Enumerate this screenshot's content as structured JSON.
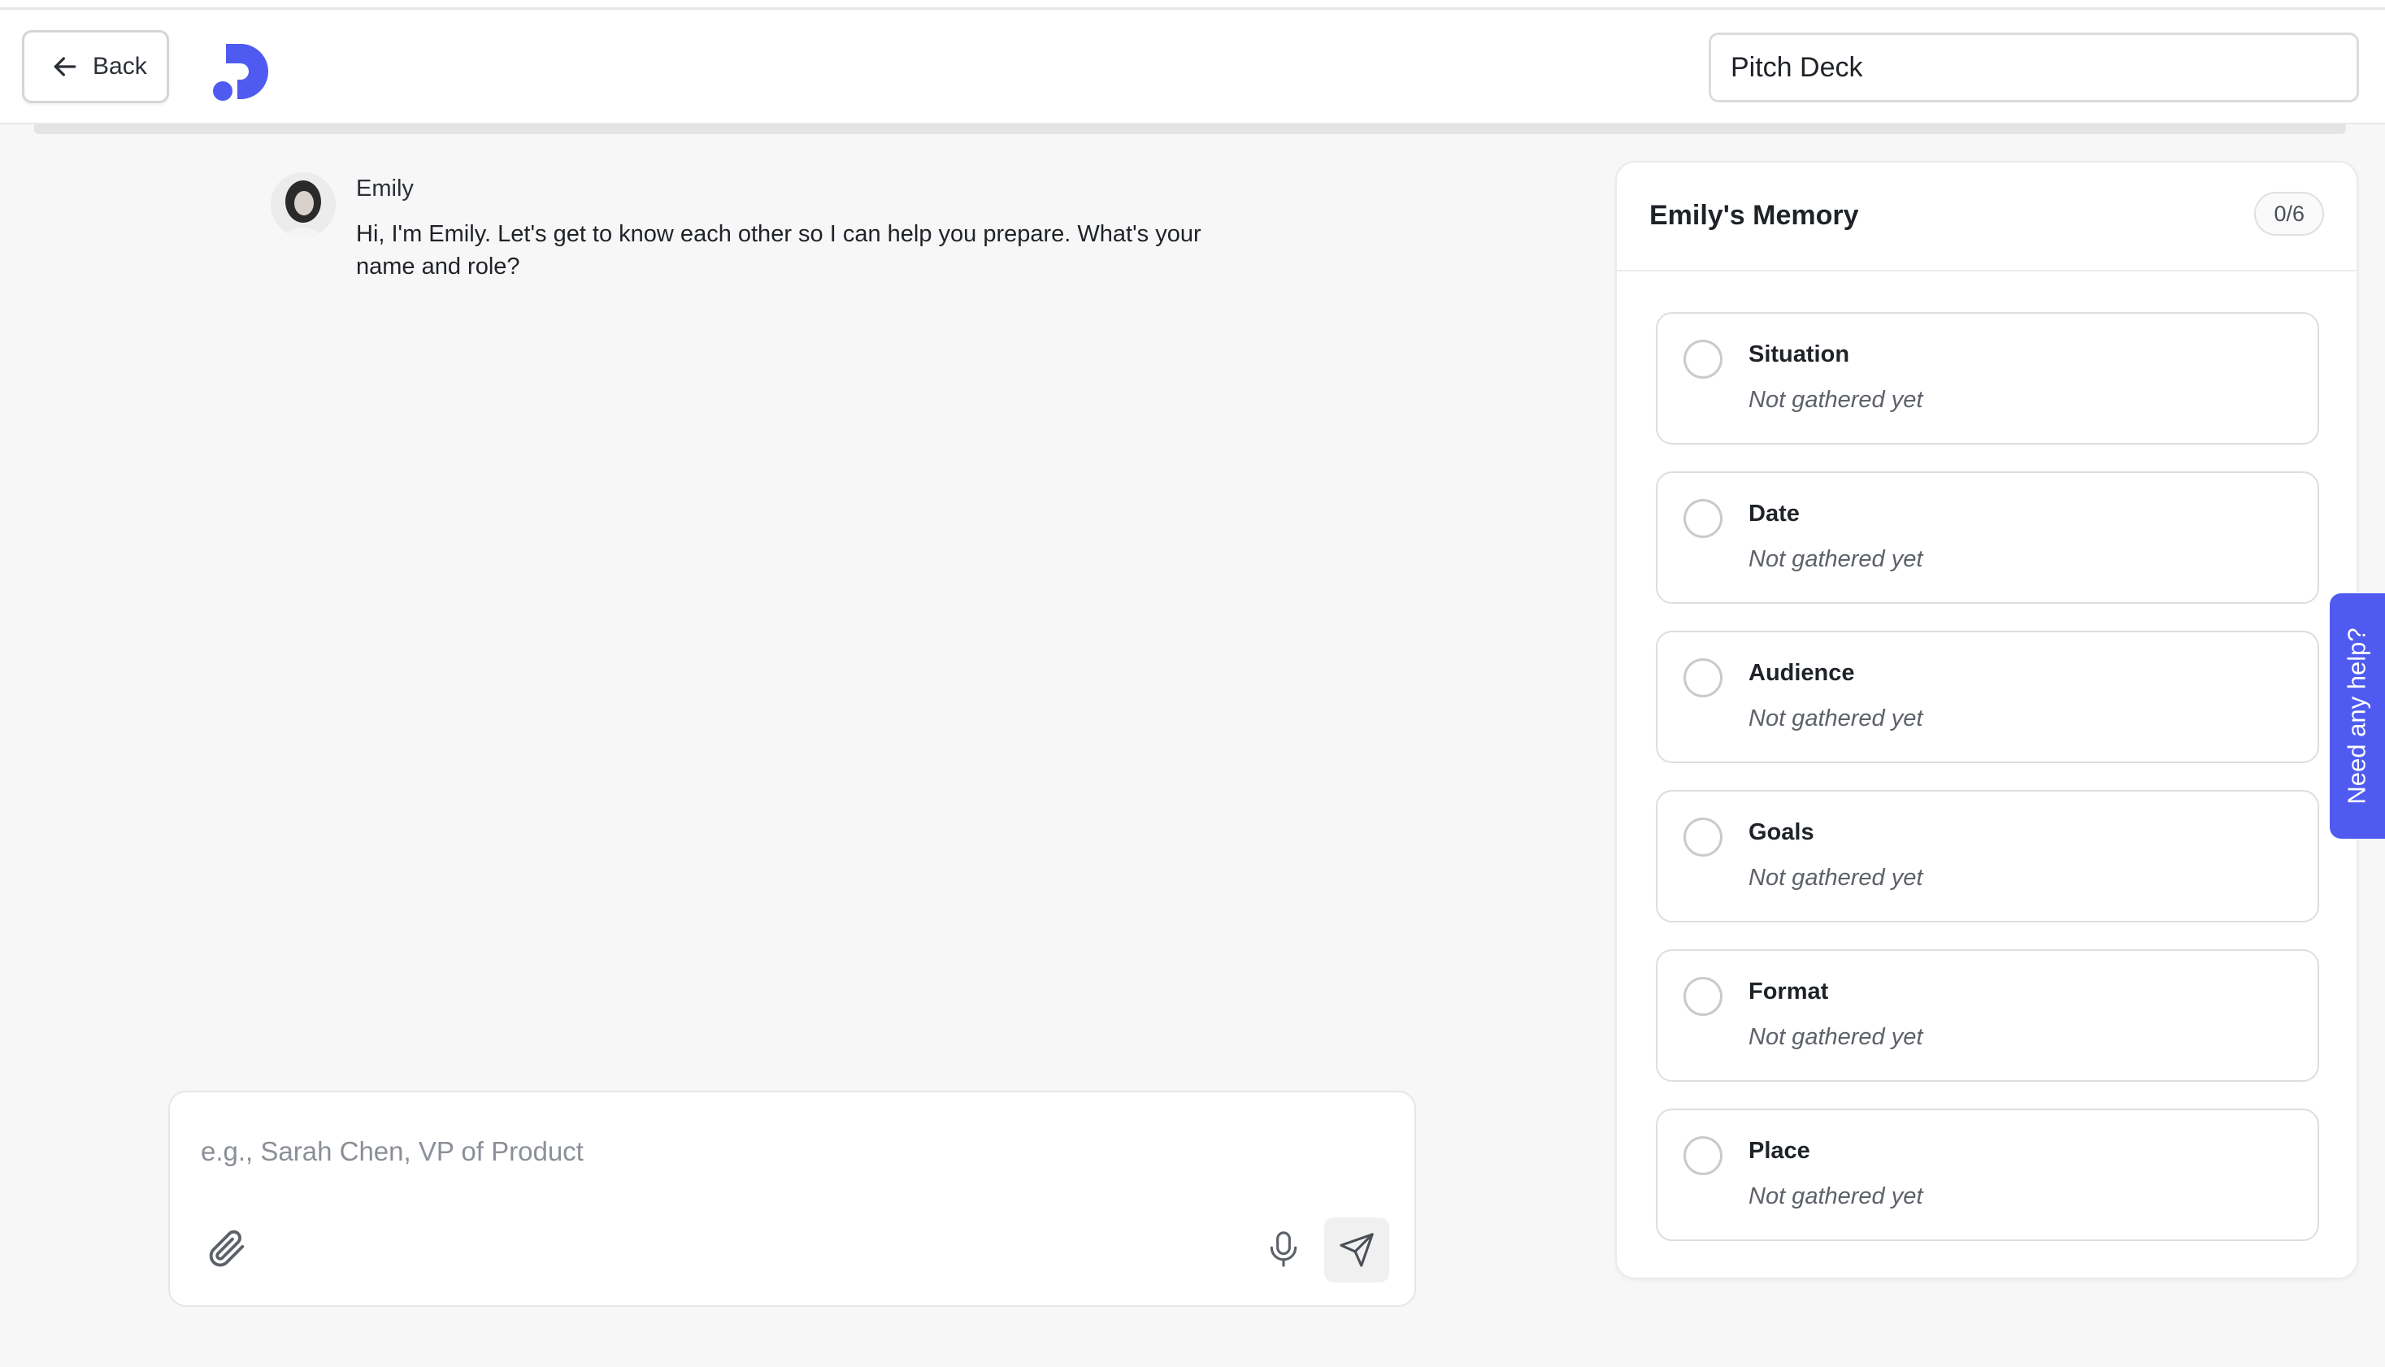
{
  "header": {
    "back_label": "Back",
    "title_value": "Pitch Deck",
    "brand_color": "#4f5bf0"
  },
  "chat": {
    "messages": [
      {
        "sender": "Emily",
        "text": "Hi, I'm Emily. Let's get to know each other so I can help you prepare. What's your name and role?"
      }
    ],
    "composer": {
      "placeholder": "e.g., Sarah Chen, VP of Product",
      "value": ""
    }
  },
  "memory": {
    "title": "Emily's Memory",
    "count": "0/6",
    "items": [
      {
        "label": "Situation",
        "status": "Not gathered yet"
      },
      {
        "label": "Date",
        "status": "Not gathered yet"
      },
      {
        "label": "Audience",
        "status": "Not gathered yet"
      },
      {
        "label": "Goals",
        "status": "Not gathered yet"
      },
      {
        "label": "Format",
        "status": "Not gathered yet"
      },
      {
        "label": "Place",
        "status": "Not gathered yet"
      }
    ]
  },
  "help": {
    "label": "Need any help?"
  },
  "icons": {
    "back": "arrow-left-icon",
    "logo": "brand-logo",
    "attach": "paperclip-icon",
    "mic": "microphone-icon",
    "send": "send-icon"
  }
}
